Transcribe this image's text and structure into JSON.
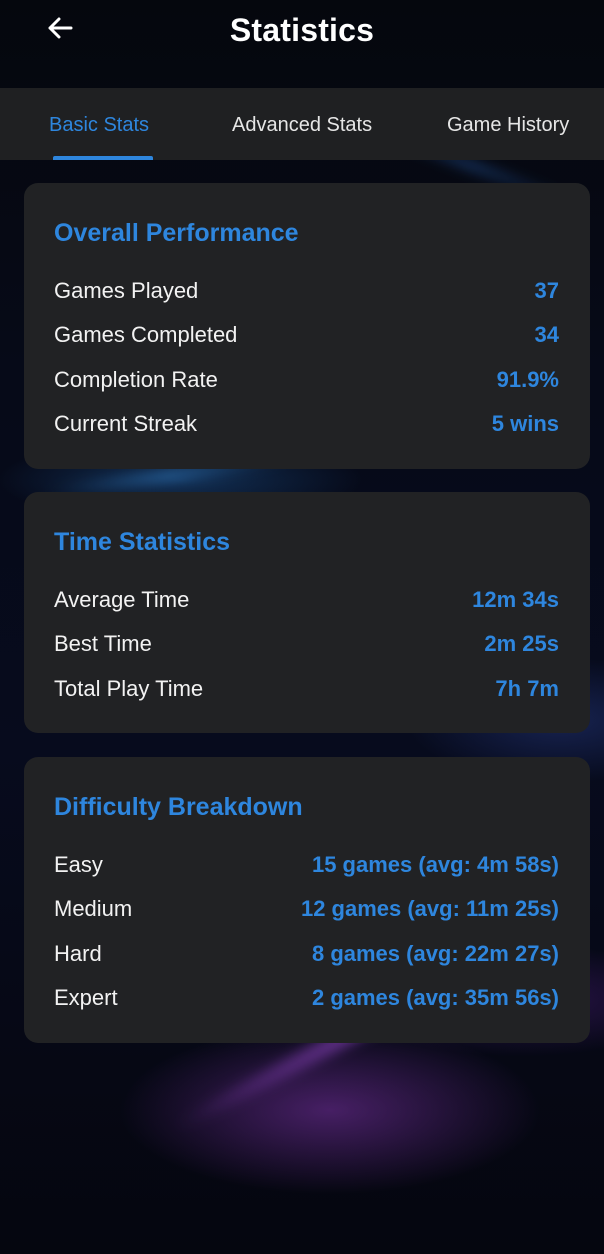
{
  "header": {
    "title": "Statistics",
    "back_icon": "arrow-left-icon"
  },
  "tabs": [
    {
      "label": "Basic Stats",
      "active": true
    },
    {
      "label": "Advanced Stats",
      "active": false
    },
    {
      "label": "Game History",
      "active": false
    }
  ],
  "colors": {
    "accent": "#2e86de",
    "card_bg": "#212224",
    "tabbar_bg": "#1f2022"
  },
  "overall_performance": {
    "title": "Overall Performance",
    "rows": [
      {
        "label": "Games Played",
        "value": "37"
      },
      {
        "label": "Games Completed",
        "value": "34"
      },
      {
        "label": "Completion Rate",
        "value": "91.9%"
      },
      {
        "label": "Current Streak",
        "value": "5 wins"
      }
    ]
  },
  "time_statistics": {
    "title": "Time Statistics",
    "rows": [
      {
        "label": "Average Time",
        "value": "12m 34s"
      },
      {
        "label": "Best Time",
        "value": "2m 25s"
      },
      {
        "label": "Total Play Time",
        "value": "7h 7m"
      }
    ]
  },
  "difficulty_breakdown": {
    "title": "Difficulty Breakdown",
    "rows": [
      {
        "label": "Easy",
        "value": "15 games (avg: 4m 58s)"
      },
      {
        "label": "Medium",
        "value": "12 games (avg: 11m 25s)"
      },
      {
        "label": "Hard",
        "value": "8 games (avg: 22m 27s)"
      },
      {
        "label": "Expert",
        "value": "2 games (avg: 35m 56s)"
      }
    ]
  }
}
